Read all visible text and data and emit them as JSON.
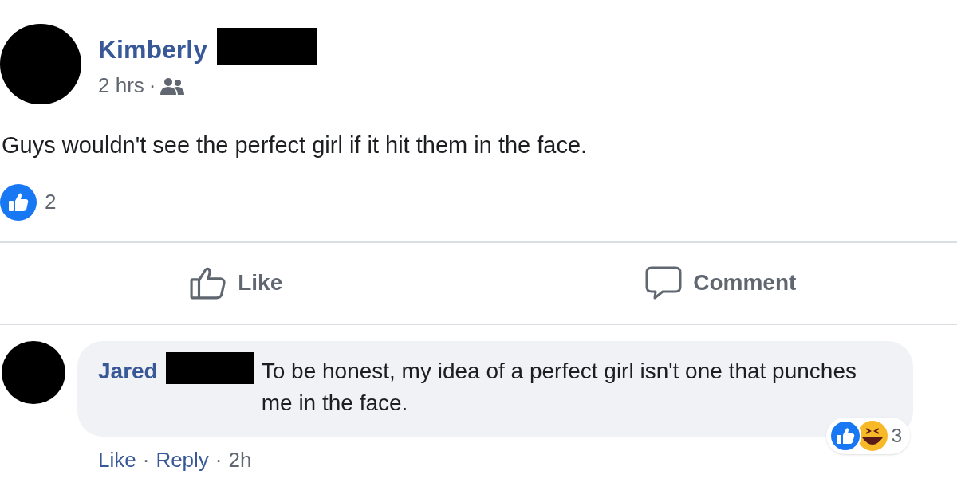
{
  "post": {
    "author": "Kimberly",
    "time": "2 hrs",
    "separator": "·",
    "text": "Guys wouldn't see the perfect girl if it hit them in the face.",
    "reaction_count": "2"
  },
  "actions": [
    {
      "kind": "like",
      "label": "Like"
    },
    {
      "kind": "comment",
      "label": "Comment"
    }
  ],
  "comment": {
    "author": "Jared",
    "text": "To be honest, my idea of a perfect girl isn't one that punches me in the face.",
    "reaction_count": "3",
    "footer": [
      {
        "kind": "link",
        "text": "Like"
      },
      {
        "kind": "separator",
        "text": "·"
      },
      {
        "kind": "link",
        "text": "Reply"
      },
      {
        "kind": "separator",
        "text": "·"
      },
      {
        "kind": "time",
        "text": "2h"
      }
    ]
  }
}
